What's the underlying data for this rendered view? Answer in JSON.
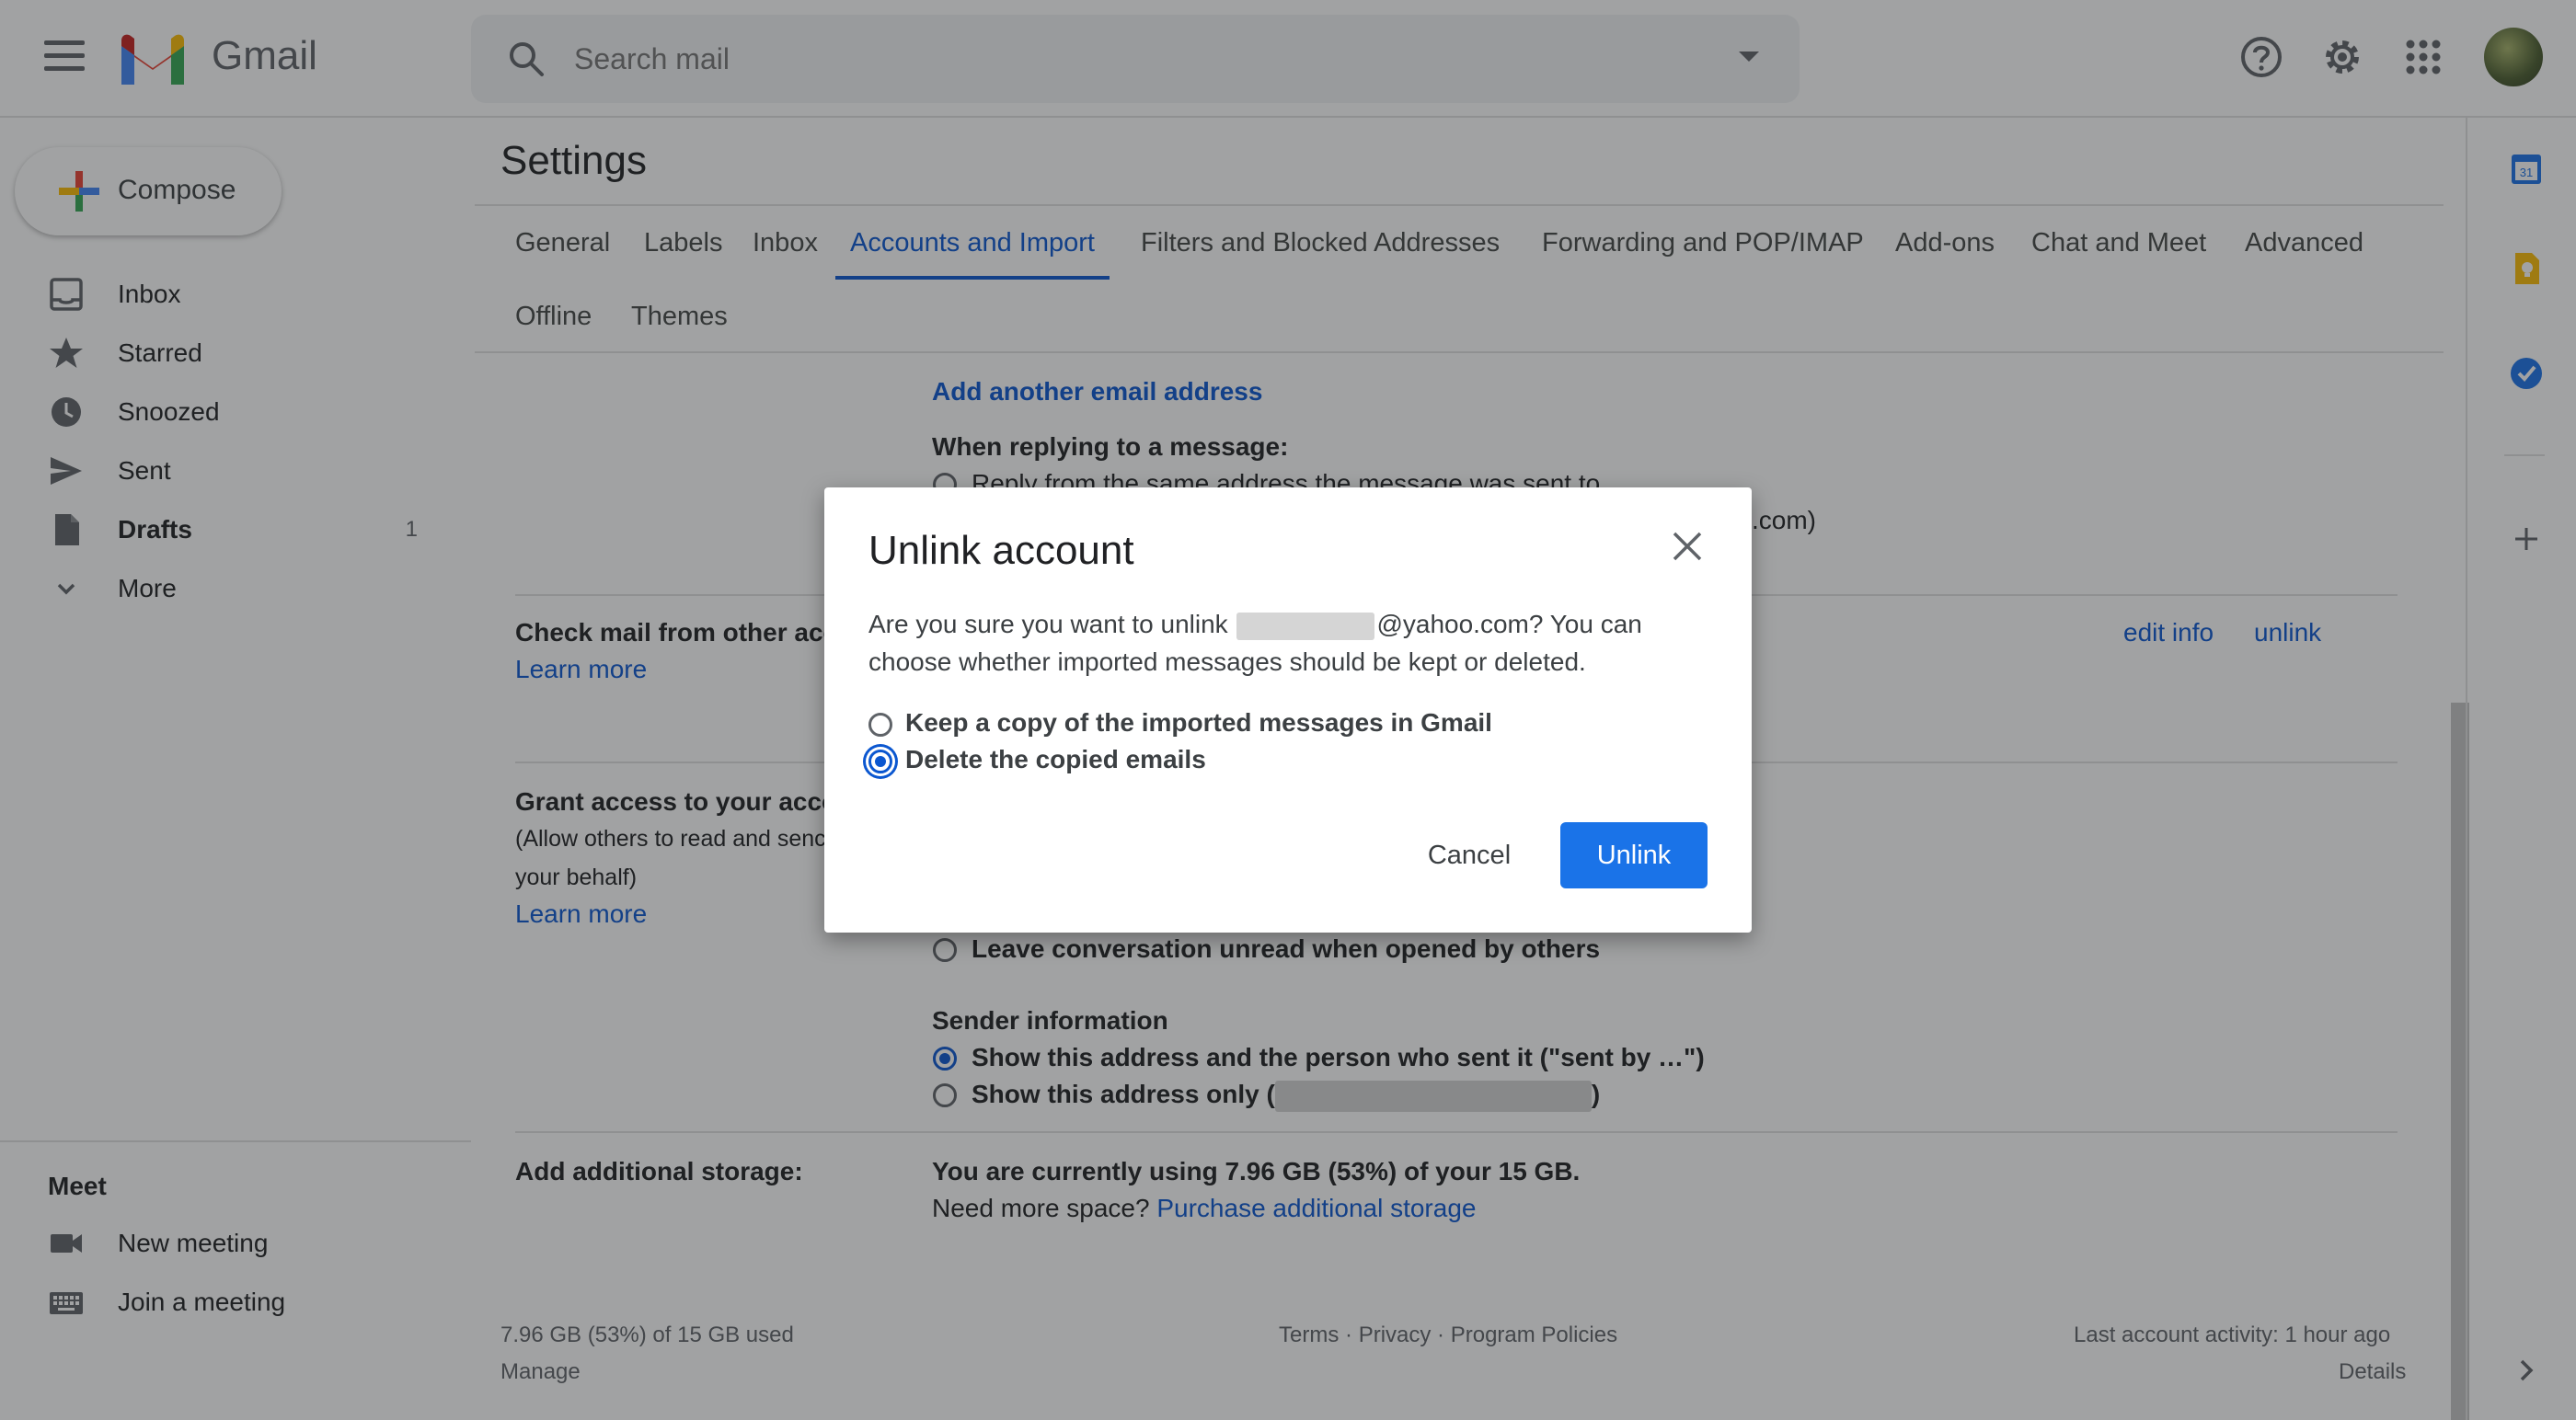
{
  "app": {
    "name": "Gmail"
  },
  "search": {
    "placeholder": "Search mail"
  },
  "compose": {
    "label": "Compose"
  },
  "nav": {
    "items": [
      {
        "label": "Inbox",
        "icon": "inbox-icon",
        "count": ""
      },
      {
        "label": "Starred",
        "icon": "star-icon",
        "count": ""
      },
      {
        "label": "Snoozed",
        "icon": "clock-icon",
        "count": ""
      },
      {
        "label": "Sent",
        "icon": "send-icon",
        "count": ""
      },
      {
        "label": "Drafts",
        "icon": "draft-icon",
        "count": "1"
      },
      {
        "label": "More",
        "icon": "chevron-down-icon",
        "count": ""
      }
    ]
  },
  "meet": {
    "title": "Meet",
    "items": [
      {
        "label": "New meeting",
        "icon": "video-icon"
      },
      {
        "label": "Join a meeting",
        "icon": "keyboard-icon"
      }
    ]
  },
  "settings": {
    "title": "Settings",
    "tabs": [
      {
        "label": "General"
      },
      {
        "label": "Labels"
      },
      {
        "label": "Inbox"
      },
      {
        "label": "Accounts and Import",
        "active": true
      },
      {
        "label": "Filters and Blocked Addresses"
      },
      {
        "label": "Forwarding and POP/IMAP"
      },
      {
        "label": "Add-ons"
      },
      {
        "label": "Chat and Meet"
      },
      {
        "label": "Advanced"
      },
      {
        "label": "Offline"
      },
      {
        "label": "Themes"
      }
    ],
    "add_email_link": "Add another email address",
    "reply_heading": "When replying to a message:",
    "reply_option_1": "Reply from the same address the message was sent to",
    "reply_option_2_tail": ".com)",
    "check_mail_label": "Check mail from other acc",
    "learn_more": "Learn more",
    "edit_info": "edit info",
    "unlink": "unlink",
    "grant_access_label": "Grant access to your acco",
    "grant_access_note_1": "(Allow others to read and senc",
    "grant_access_note_2": "your behalf)",
    "leave_unread": "Leave conversation unread when opened by others",
    "sender_info_heading": "Sender information",
    "sender_option_1": "Show this address and the person who sent it (\"sent by …\")",
    "sender_option_2_prefix": "Show this address only (",
    "sender_option_2_suffix": ")",
    "storage_label": "Add additional storage:",
    "storage_usage": "You are currently using 7.96 GB (53%) of your 15 GB.",
    "storage_more": "Need more space?",
    "storage_link": "Purchase additional storage"
  },
  "footer": {
    "usage": "7.96 GB (53%) of 15 GB used",
    "manage": "Manage",
    "terms": "Terms",
    "sep": "·",
    "privacy": "Privacy",
    "policies": "Program Policies",
    "last_activity": "Last account activity: 1 hour ago",
    "details": "Details"
  },
  "dialog": {
    "title": "Unlink account",
    "body_prefix": "Are you sure you want to unlink",
    "body_suffix": "@yahoo.com? You can choose whether imported messages should be kept or deleted.",
    "option_keep": "Keep a copy of the imported messages in Gmail",
    "option_delete": "Delete the copied emails",
    "cancel_label": "Cancel",
    "unlink_label": "Unlink"
  },
  "side_panel": {
    "calendar_day": "31"
  },
  "colors": {
    "accent": "#0b57d0",
    "button": "#1a73e8"
  }
}
